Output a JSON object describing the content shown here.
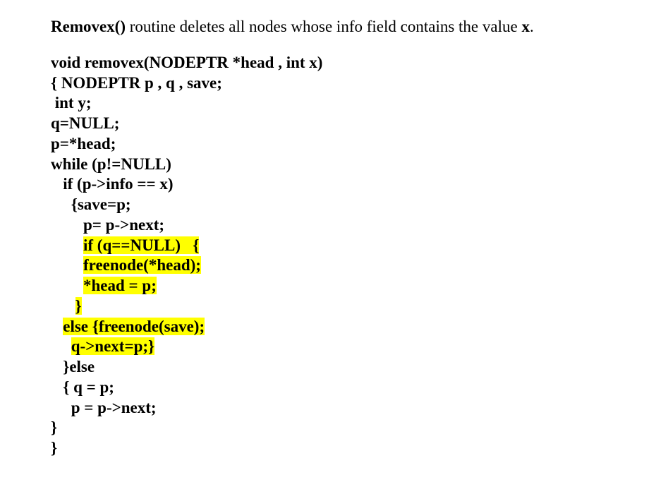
{
  "intro": {
    "fn_name": "Removex()",
    "rest": " routine deletes all nodes whose info field contains the value ",
    "var": "x",
    "period": "."
  },
  "code": {
    "l1": "void removex(NODEPTR *head , int x)",
    "l2": "{ NODEPTR p , q , save;",
    "l3": " int y;",
    "l4": "q=NULL;",
    "l5": "p=*head;",
    "l6": "while (p!=NULL)",
    "l7": "   if (p->info == x)",
    "l8": "     {save=p;",
    "l9a": "        p= p->next;",
    "l10a": "        ",
    "l10h": "if (q==NULL)   {",
    "l11a": "        ",
    "l11h": "freenode(*head);",
    "l12a": "        ",
    "l12h": "*head = p;",
    "l13a": "      ",
    "l13h": "}",
    "l14a": "   ",
    "l14h": "else {freenode(save);",
    "l15a": "     ",
    "l15h": "q->next=p;}",
    "l16": "   }else",
    "l17": "   { q = p;",
    "l18": "     p = p->next;",
    "l19": "}",
    "l20": "}"
  }
}
